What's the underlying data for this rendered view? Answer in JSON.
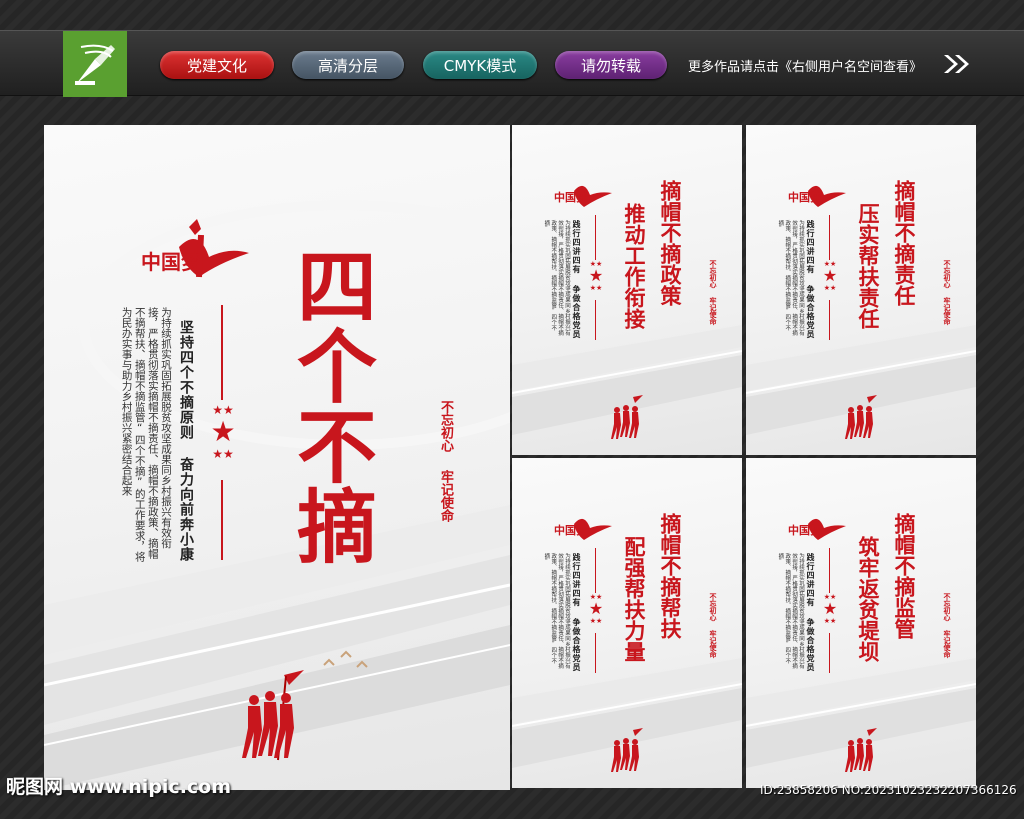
{
  "banner": {
    "tags": [
      "党建文化",
      "高清分层",
      "CMYK模式",
      "请勿转载"
    ],
    "more_text": "更多作品请点击《右侧用户名空间查看》",
    "icons": [
      "pen-logo-icon",
      "double-arrow-icon"
    ],
    "colors": {
      "tag1": "#c8161d",
      "tag2": "#556677",
      "tag3": "#1f7772",
      "tag4": "#6f2c86"
    }
  },
  "main_poster": {
    "title": "四个不摘",
    "subtitle": "坚持四个不摘原则 奋力向前奔小康",
    "slogan_a": "不忘初心",
    "slogan_b": "牢记使命",
    "logo_text": "中国梦",
    "body": "为持续抓实巩固拓展脱贫攻坚成果同乡村振兴有效衔接，严格贯彻落实摘帽不摘责任、摘帽不摘政策、摘帽不摘帮扶、摘帽不摘监管“四个不摘”的工作要求，将为民办实事与助力乡村振兴紧密结合起来"
  },
  "small_posters": [
    {
      "title_a": "摘帽不摘政策",
      "title_b": "推动工作衔接"
    },
    {
      "title_a": "摘帽不摘责任",
      "title_b": "压实帮扶责任"
    },
    {
      "title_a": "摘帽不摘帮扶",
      "title_b": "配强帮扶力量"
    },
    {
      "title_a": "摘帽不摘监管",
      "title_b": "筑牢返贫堤坝"
    }
  ],
  "small_common": {
    "logo_text": "中国梦",
    "subtitle": "践行四讲四有 争做合格党员",
    "slogan": "不忘初心 牢记使命",
    "body": "为持续抓实巩固拓展脱贫攻坚成果同乡村振兴有效衔接，严格贯彻落实摘帽不摘责任、摘帽不摘政策、摘帽不摘帮扶、摘帽不摘监管“四个不摘”"
  },
  "watermark": {
    "left": "昵图网 www.nipic.com",
    "right": "ID:23858206 NO:20231023232207366126"
  },
  "accent_color": "#c8161d"
}
